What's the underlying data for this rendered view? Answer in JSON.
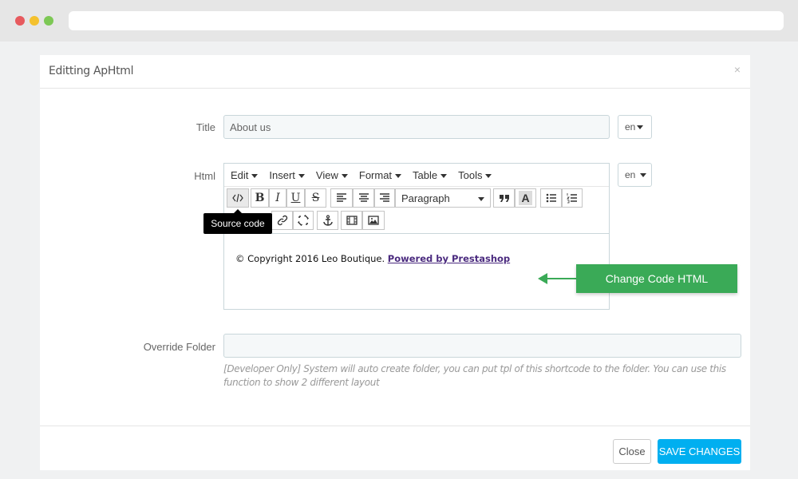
{
  "modal": {
    "title": "Editting ApHtml",
    "close_symbol": "×"
  },
  "form": {
    "title_label": "Title",
    "title_value": "About us",
    "html_label": "Html",
    "lang": "en",
    "override_label": "Override Folder",
    "override_value": "",
    "help_text": "[Developer Only] System will auto create folder, you can put tpl of this shortcode to the folder. You can use this function to show 2 different layout"
  },
  "editor": {
    "menus": [
      "Edit",
      "Insert",
      "View",
      "Format",
      "Table",
      "Tools"
    ],
    "block_format": "Paragraph",
    "content_prefix": "© Copyright 2016 Leo Boutique. ",
    "content_link": "Powered by Prestashop",
    "tooltip": "Source code",
    "toolbar_icons": [
      "code-icon",
      "bold-icon",
      "italic-icon",
      "underline-icon",
      "strikethrough-icon",
      "align-left-icon",
      "align-center-icon",
      "align-right-icon",
      "blockquote-icon",
      "text-color-icon",
      "bullet-list-icon",
      "numbered-list-icon",
      "link-icon",
      "unlink-icon",
      "anchor-icon",
      "video-icon",
      "image-icon"
    ]
  },
  "annotation": {
    "label": "Change Code HTML",
    "color": "#3aaa57"
  },
  "footer": {
    "close_label": "Close",
    "save_label": "SAVE CHANGES",
    "save_color": "#00aff0"
  }
}
